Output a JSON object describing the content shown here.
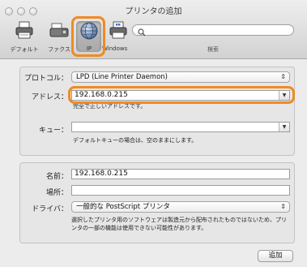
{
  "window": {
    "title": "プリンタの追加"
  },
  "toolbar": {
    "items": [
      {
        "label": "デフォルト",
        "icon": "printer-icon"
      },
      {
        "label": "ファクス",
        "icon": "fax-icon"
      },
      {
        "label": "IP",
        "icon": "ip-globe-icon",
        "selected": true
      },
      {
        "label": "Windows",
        "icon": "windows-printer-icon"
      }
    ],
    "search_label": "検索",
    "search_value": ""
  },
  "form": {
    "protocol_label": "プロトコル：",
    "protocol_value": "LPD (Line Printer Daemon)",
    "address_label": "アドレス：",
    "address_value": "192.168.0.215",
    "address_hint": "完全で正しいアドレスです。",
    "queue_label": "キュー：",
    "queue_value": "",
    "queue_hint": "デフォルトキューの場合は、空のままにします。"
  },
  "info": {
    "name_label": "名前：",
    "name_value": "192.168.0.215",
    "location_label": "場所：",
    "location_value": "",
    "driver_label": "ドライバ：",
    "driver_value": "一般的な PostScript プリンタ",
    "driver_note_line1": "選択したプリンタ用のソフトウェアは製造元から配布されたものではないため、プリ",
    "driver_note_line2": "ンタの一部の機能は使用できない可能性があります。"
  },
  "footer": {
    "add_button": "追加"
  },
  "colors": {
    "highlight": "#f08a22"
  }
}
